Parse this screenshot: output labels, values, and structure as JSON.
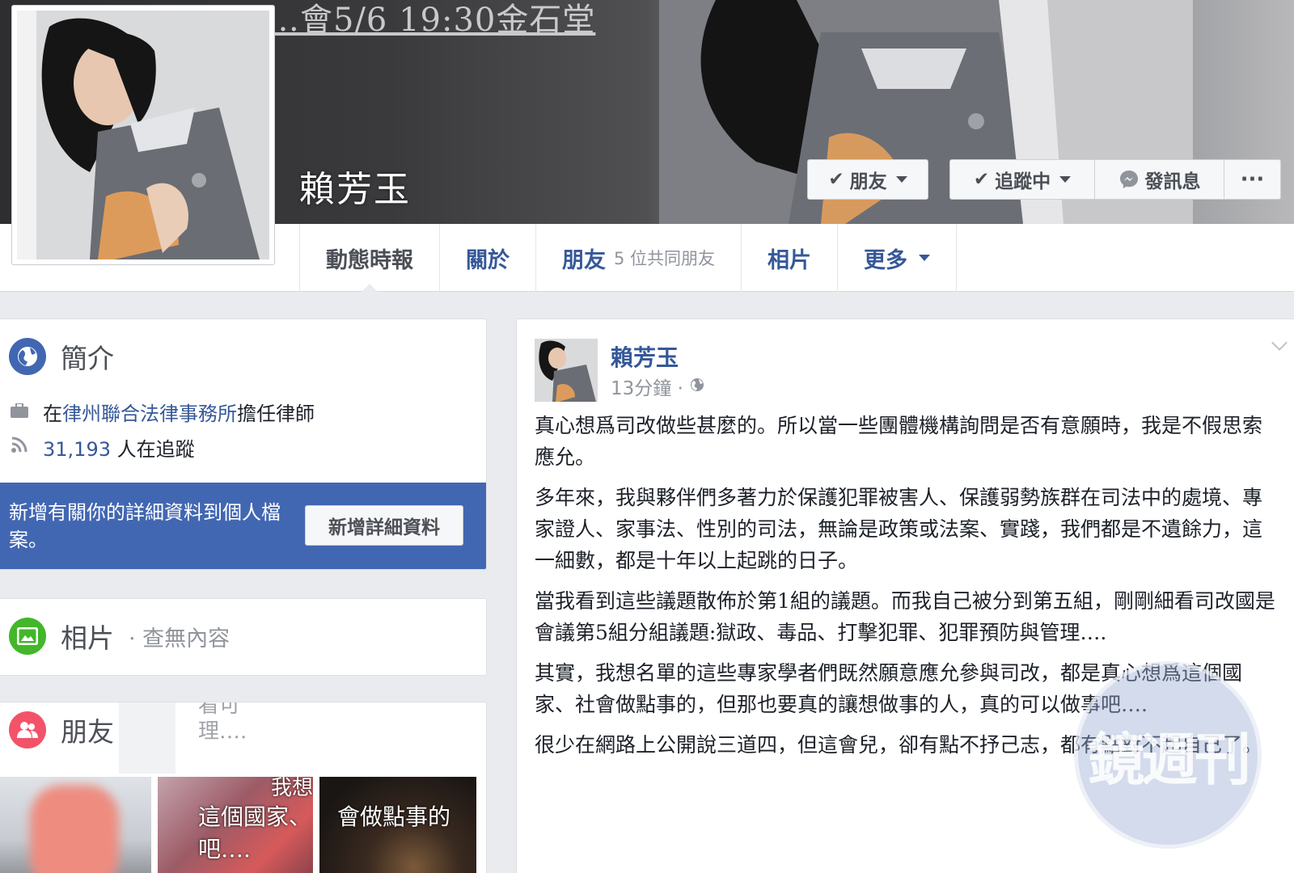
{
  "cover": {
    "banner_text": "…會5/6 19:30金石堂"
  },
  "profile": {
    "name": "賴芳玉"
  },
  "actions": {
    "friend_label": "朋友",
    "following_label": "追蹤中",
    "message_label": "發訊息",
    "more_label": "···"
  },
  "tabs": [
    {
      "label": "動態時報"
    },
    {
      "label": "關於"
    },
    {
      "label": "朋友",
      "sub": "5 位共同朋友"
    },
    {
      "label": "相片"
    },
    {
      "label": "更多"
    }
  ],
  "intro": {
    "title": "簡介",
    "work_prefix": "在",
    "work_link": "律州聯合法律事務所",
    "work_suffix": "擔任律師",
    "followers_count": "31,193",
    "followers_suffix": "人在追蹤",
    "cta_text": "新增有關你的詳細資料到個人檔案。",
    "cta_button": "新增詳細資料"
  },
  "photos": {
    "title": "相片",
    "empty": "· 查無內容"
  },
  "friends": {
    "title": "朋友",
    "ghost_text_1": "看可",
    "ghost_text_2": "理….",
    "thumb_text_1": "我想",
    "thumb_text_2": "這個國家、",
    "thumb_text_3": "吧….",
    "thumb_text_4": "會做點事的"
  },
  "post": {
    "author": "賴芳玉",
    "time": "13分鐘 ·",
    "paragraphs": [
      "真心想爲司改做些甚麼的。所以當一些團體機構詢問是否有意願時，我是不假思索應允。",
      "多年來，我與夥伴們多著力於保護犯罪被害人、保護弱勢族群在司法中的處境、專家證人、家事法、性別的司法，無論是政策或法案、實踐，我們都是不遺餘力，這一細數，都是十年以上起跳的日子。",
      "當我看到這些議題散佈於第1組的議題。而我自己被分到第五組，剛剛細看司改國是會議第5組分組議題:獄政、毒品、打擊犯罪、犯罪預防與管理….",
      "其實，我想名單的這些專家學者們既然願意應允參與司改，都是真心想爲這個國家、社會做點事的，但那也要真的讓想做事的人，真的可以做事吧….",
      "很少在網路上公開說三道四，但這會兒，卻有點不抒己志，都有點對不起自己了。"
    ]
  },
  "watermark": {
    "text": "鏡週刊"
  },
  "colors": {
    "link_blue": "#365899",
    "brand_blue": "#4267b2",
    "page_bg": "#e9ebee"
  }
}
